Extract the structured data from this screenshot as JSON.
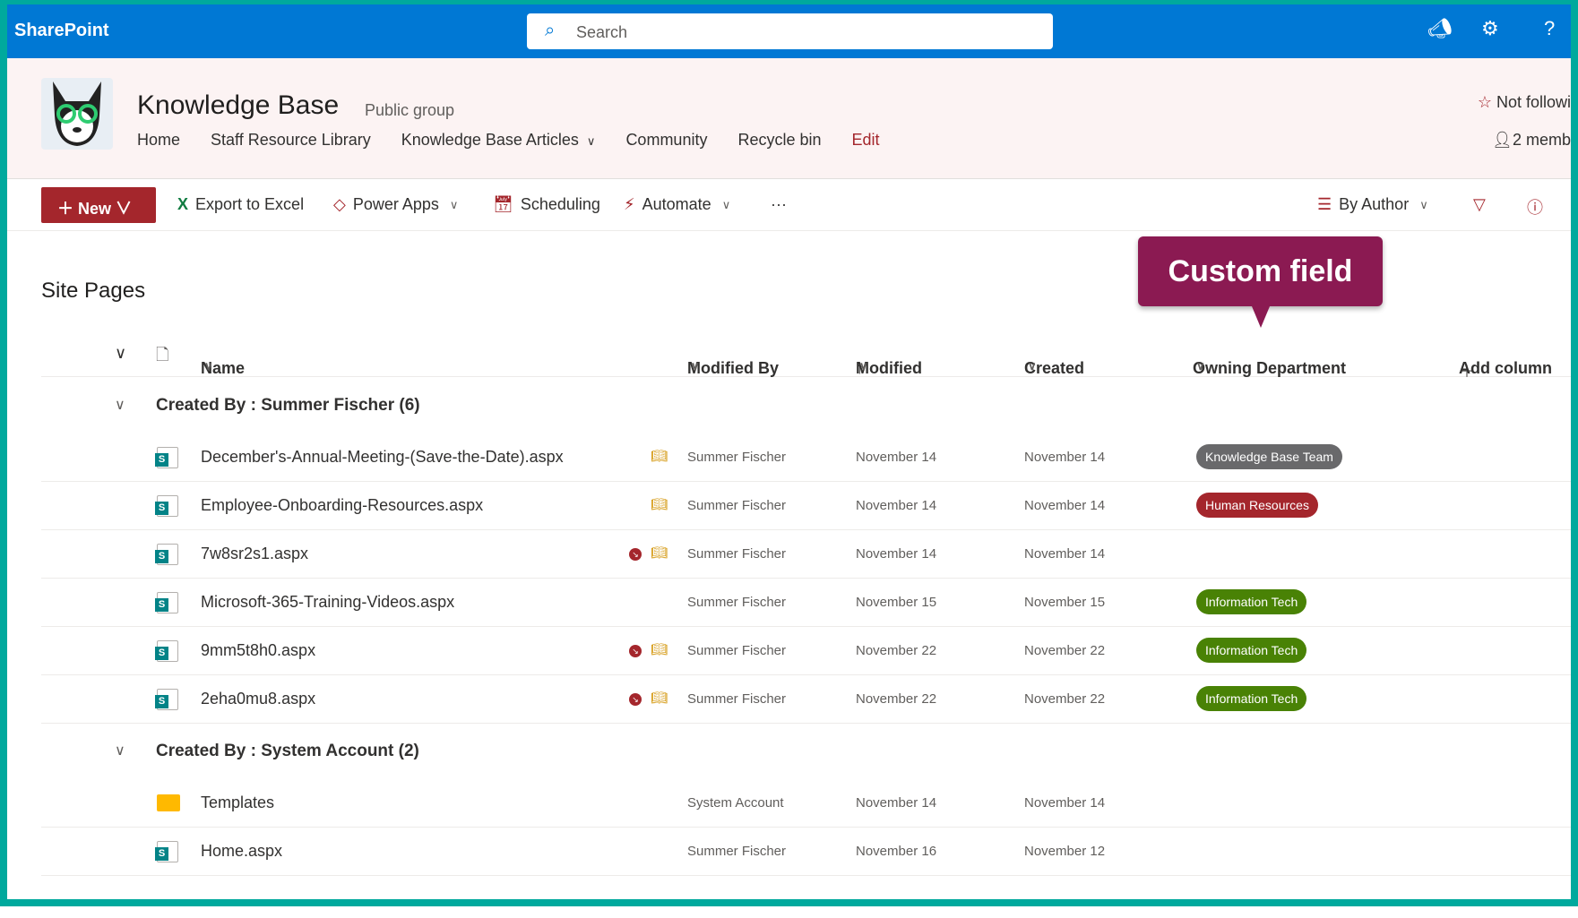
{
  "topbar": {
    "brand": "SharePoint",
    "search_placeholder": "Search"
  },
  "site": {
    "title": "Knowledge Base",
    "group_type": "Public group",
    "follow": "Not followi",
    "members": "2 memb",
    "nav": [
      "Home",
      "Staff Resource Library",
      "Knowledge Base Articles",
      "Community",
      "Recycle bin",
      "Edit"
    ]
  },
  "commands": {
    "new": "New",
    "export": "Export to Excel",
    "power_apps": "Power Apps",
    "scheduling": "Scheduling",
    "automate": "Automate",
    "more": "···",
    "view": "By Author"
  },
  "list": {
    "title": "Site Pages",
    "columns": {
      "name": "Name",
      "modified_by": "Modified By",
      "modified": "Modified",
      "created": "Created",
      "owning_department": "Owning Department",
      "add_column": "Add column"
    },
    "groups": [
      {
        "label": "Created By : Summer Fischer (6)",
        "rows": [
          {
            "name": "December's-Annual-Meeting-(Save-the-Date).aspx",
            "modified_by": "Summer Fischer",
            "modified": "November 14",
            "created": "November 14",
            "department": "Knowledge Base Team",
            "dept_color": "#69696b",
            "alert": false,
            "book": true
          },
          {
            "name": "Employee-Onboarding-Resources.aspx",
            "modified_by": "Summer Fischer",
            "modified": "November 14",
            "created": "November 14",
            "department": "Human Resources",
            "dept_color": "#a4262c",
            "alert": false,
            "book": true
          },
          {
            "name": "7w8sr2s1.aspx",
            "modified_by": "Summer Fischer",
            "modified": "November 14",
            "created": "November 14",
            "department": "",
            "alert": true,
            "book": true
          },
          {
            "name": "Microsoft-365-Training-Videos.aspx",
            "modified_by": "Summer Fischer",
            "modified": "November 15",
            "created": "November 15",
            "department": "Information Tech",
            "dept_color": "#498205",
            "alert": false,
            "book": false
          },
          {
            "name": "9mm5t8h0.aspx",
            "modified_by": "Summer Fischer",
            "modified": "November 22",
            "created": "November 22",
            "department": "Information Tech",
            "dept_color": "#498205",
            "alert": true,
            "book": true
          },
          {
            "name": "2eha0mu8.aspx",
            "modified_by": "Summer Fischer",
            "modified": "November 22",
            "created": "November 22",
            "department": "Information Tech",
            "dept_color": "#498205",
            "alert": true,
            "book": true
          }
        ]
      },
      {
        "label": "Created By : System Account (2)",
        "rows": [
          {
            "name": "Templates",
            "type": "folder",
            "modified_by": "System Account",
            "modified": "November 14",
            "created": "November 14",
            "department": ""
          },
          {
            "name": "Home.aspx",
            "modified_by": "Summer Fischer",
            "modified": "November 16",
            "created": "November 12",
            "department": ""
          }
        ]
      }
    ]
  },
  "callout": {
    "text": "Custom field"
  }
}
